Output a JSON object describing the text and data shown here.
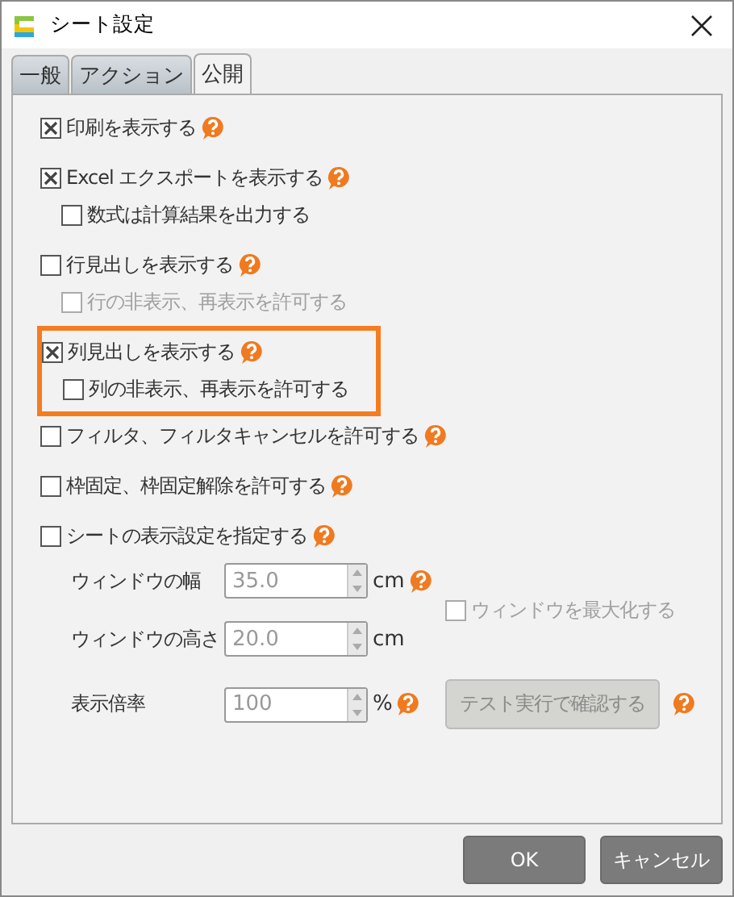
{
  "window": {
    "title": "シート設定"
  },
  "tabs": [
    {
      "label": "一般",
      "selected": false
    },
    {
      "label": "アクション",
      "selected": false
    },
    {
      "label": "公開",
      "selected": true
    }
  ],
  "options": [
    {
      "label": "印刷を表示する",
      "checked": true,
      "help": true,
      "disabled": false,
      "highlighted": false
    },
    {
      "label": "Excel エクスポートを表示する",
      "checked": true,
      "help": true,
      "disabled": false,
      "highlighted": false,
      "children": [
        {
          "label": "数式は計算結果を出力する",
          "checked": false,
          "help": false,
          "disabled": false
        }
      ]
    },
    {
      "label": "行見出しを表示する",
      "checked": false,
      "help": true,
      "disabled": false,
      "highlighted": false,
      "children": [
        {
          "label": "行の非表示、再表示を許可する",
          "checked": false,
          "help": false,
          "disabled": true
        }
      ]
    },
    {
      "label": "列見出しを表示する",
      "checked": true,
      "help": true,
      "disabled": false,
      "highlighted": true,
      "children": [
        {
          "label": "列の非表示、再表示を許可する",
          "checked": false,
          "help": false,
          "disabled": false
        }
      ]
    },
    {
      "label": "フィルタ、フィルタキャンセルを許可する",
      "checked": false,
      "help": true,
      "disabled": false,
      "highlighted": false
    },
    {
      "label": "枠固定、枠固定解除を許可する",
      "checked": false,
      "help": true,
      "disabled": false,
      "highlighted": false
    },
    {
      "label": "シートの表示設定を指定する",
      "checked": false,
      "help": true,
      "disabled": false,
      "highlighted": false
    }
  ],
  "display_settings": {
    "rows": [
      {
        "label": "ウィンドウの幅",
        "value": "35.0",
        "unit": "cm",
        "help": true,
        "disabled": true
      },
      {
        "label": "ウィンドウの高さ",
        "value": "20.0",
        "unit": "cm",
        "help": false,
        "disabled": true
      },
      {
        "label": "表示倍率",
        "value": "100",
        "unit": "%",
        "help": true,
        "disabled": true
      }
    ],
    "maximize": {
      "label": "ウィンドウを最大化する",
      "checked": false,
      "disabled": true
    },
    "test_button": {
      "label": "テスト実行で確認する",
      "disabled": true,
      "help": true
    }
  },
  "buttons": [
    {
      "label": "OK"
    },
    {
      "label": "キャンセル"
    }
  ]
}
